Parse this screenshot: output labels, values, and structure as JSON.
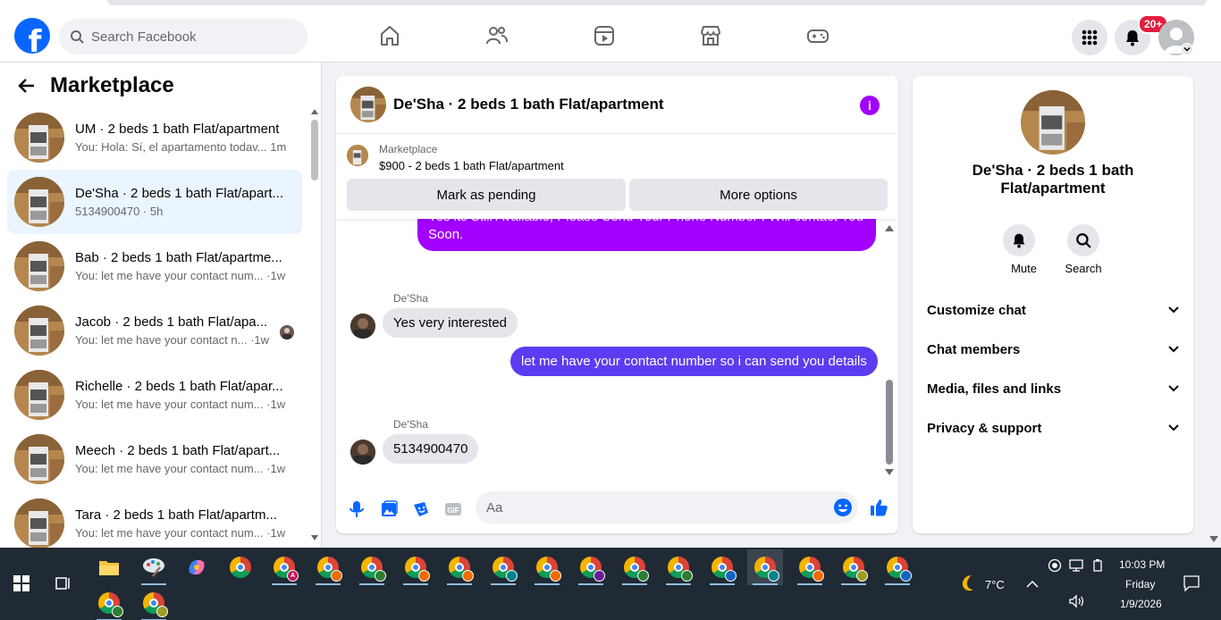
{
  "header": {
    "search_placeholder": "Search Facebook",
    "notification_badge": "20+",
    "brand_color": "#0866ff"
  },
  "sidebar": {
    "title": "Marketplace",
    "conversations": [
      {
        "title": "UM · 2 beds 1 bath Flat/apartment",
        "preview": "You: Hola: Sí, el apartamento todav... 1m"
      },
      {
        "title": "De'Sha · 2 beds 1 bath Flat/apart...",
        "preview": "5134900470 · 5h"
      },
      {
        "title": "Bab · 2 beds 1 bath Flat/apartme...",
        "preview": "You: let me have your contact num... ·1w"
      },
      {
        "title": "Jacob · 2 beds 1 bath Flat/apa...",
        "preview": "You: let me have your contact n... ·1w"
      },
      {
        "title": "Richelle · 2 beds 1 bath Flat/apar...",
        "preview": "You: let me have your contact num... ·1w"
      },
      {
        "title": "Meech · 2 beds 1 bath Flat/apart...",
        "preview": "You: let me have your contact num... ·1w"
      },
      {
        "title": "Tara · 2 beds 1 bath Flat/apartm...",
        "preview": "You: let me have your contact num... ·1w"
      }
    ]
  },
  "chat": {
    "title": "De'Sha · 2 beds 1 bath Flat/apartment",
    "marketplace_label": "Marketplace",
    "listing": "$900 - 2 beds 1 bath Flat/apartment",
    "mark_pending_label": "Mark as pending",
    "more_options_label": "More options",
    "messages": {
      "m1_line1": "Yes its Still Available, Please Send Your Phone Number I Will contact You",
      "m1_line2": "Soon.",
      "sender1": "De'Sha",
      "m2": "Yes very interested",
      "m3": "let me have your contact number so i can send you details",
      "sender2": "De'Sha",
      "m4": "5134900470"
    },
    "composer_placeholder": "Aa"
  },
  "details": {
    "name": "De'Sha · 2 beds 1 bath Flat/apartment",
    "mute_label": "Mute",
    "search_label": "Search",
    "sections": [
      "Customize chat",
      "Chat members",
      "Media, files and links",
      "Privacy & support"
    ]
  },
  "taskbar": {
    "weather": "7°C",
    "time": "10:03 PM",
    "day": "Friday",
    "date": "1/9/2026",
    "profile_letter": "A"
  }
}
